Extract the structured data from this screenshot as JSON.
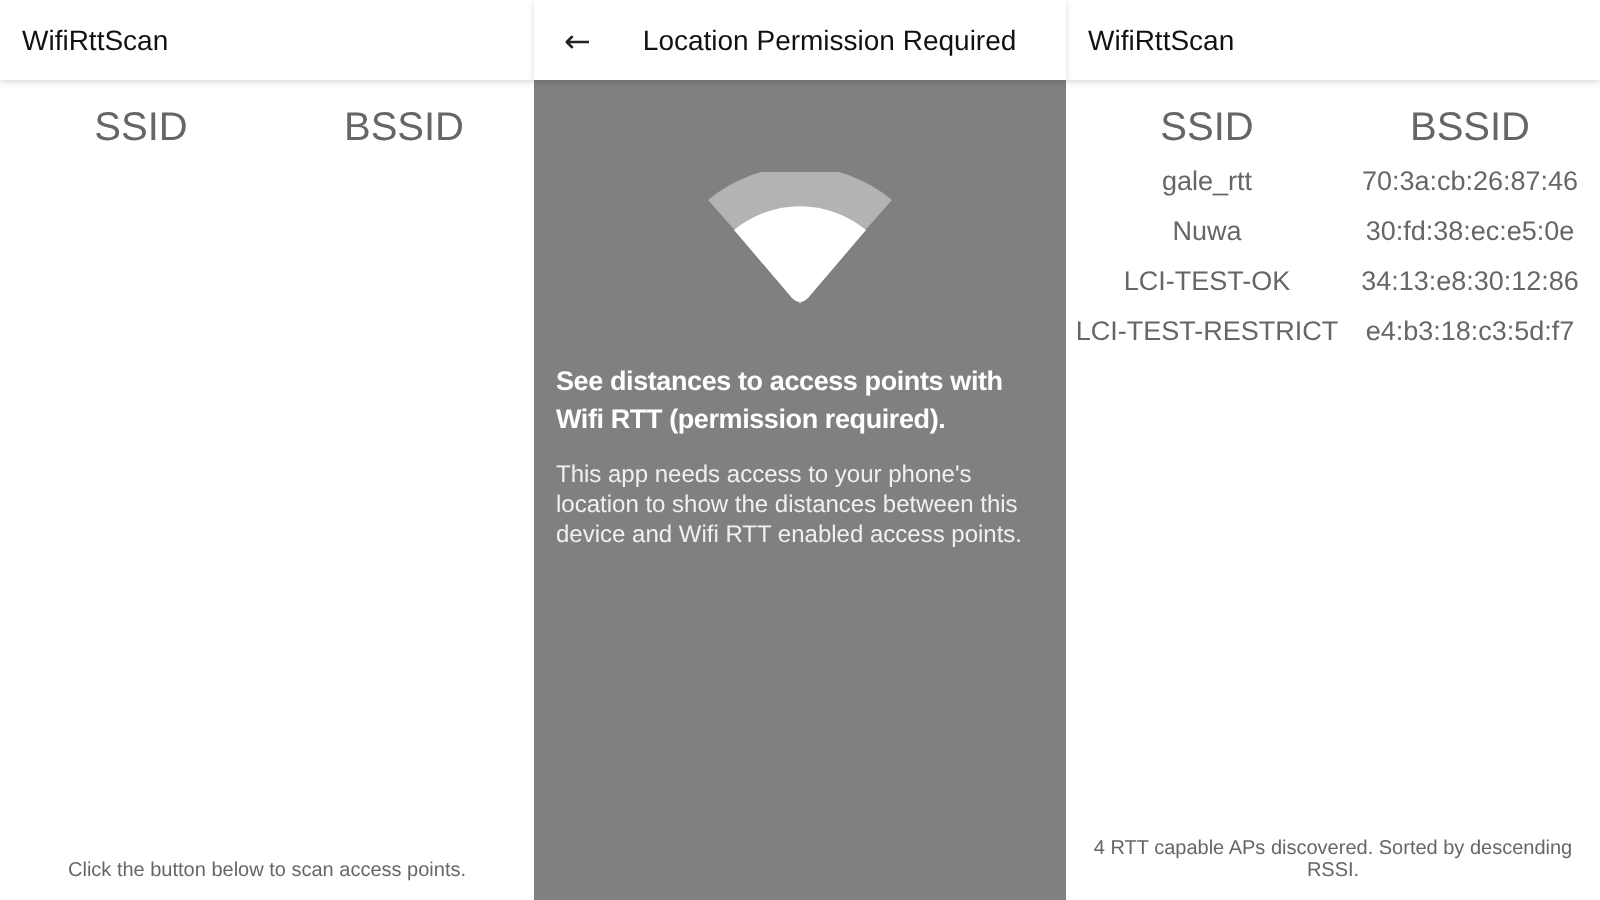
{
  "scan_screen_empty": {
    "app_title": "WifiRttScan",
    "columns": [
      "SSID",
      "BSSID"
    ],
    "footer": "Click the button below to scan access points."
  },
  "permission_screen": {
    "back_icon": "←",
    "title": "Location Permission Required",
    "heading": "See distances to access points with Wifi RTT (permission required).",
    "body": "This app needs access to your phone's location to show the distances between this device and Wifi RTT enabled access points."
  },
  "scan_screen_results": {
    "app_title": "WifiRttScan",
    "columns": [
      "SSID",
      "BSSID"
    ],
    "rows": [
      {
        "ssid": "gale_rtt",
        "bssid": "70:3a:cb:26:87:46"
      },
      {
        "ssid": "Nuwa",
        "bssid": "30:fd:38:ec:e5:0e"
      },
      {
        "ssid": "LCI-TEST-OK",
        "bssid": "34:13:e8:30:12:86"
      },
      {
        "ssid": "LCI-TEST-RESTRICT",
        "bssid": "e4:b3:18:c3:5d:f7"
      }
    ],
    "footer": "4 RTT capable APs discovered. Sorted by descending RSSI."
  }
}
